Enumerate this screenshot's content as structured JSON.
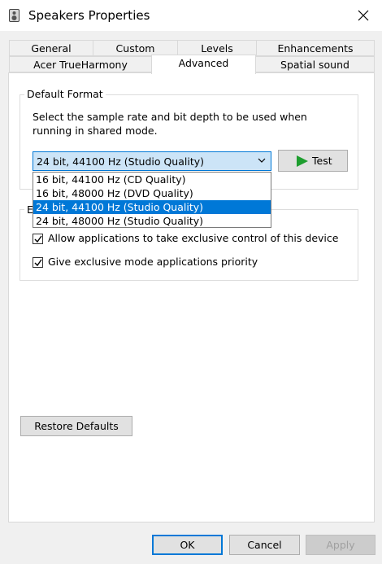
{
  "window": {
    "title": "Speakers Properties"
  },
  "tabs": {
    "row1": [
      "General",
      "Custom",
      "Levels",
      "Enhancements"
    ],
    "row2": [
      "Acer TrueHarmony",
      "Advanced",
      "Spatial sound"
    ],
    "active": "Advanced"
  },
  "default_format": {
    "legend": "Default Format",
    "description": "Select the sample rate and bit depth to be used when running in shared mode.",
    "selected": "24 bit, 44100 Hz (Studio Quality)",
    "options": [
      "16 bit, 44100 Hz (CD Quality)",
      "16 bit, 48000 Hz (DVD Quality)",
      "24 bit, 44100 Hz (Studio Quality)",
      "24 bit, 48000 Hz (Studio Quality)"
    ],
    "highlighted_index": 2,
    "test_label": "Test"
  },
  "exclusive_mode": {
    "legend_visible": "E",
    "allow_label": "Allow applications to take exclusive control of this device",
    "allow_checked": true,
    "priority_label": "Give exclusive mode applications priority",
    "priority_checked": true
  },
  "restore_defaults_label": "Restore Defaults",
  "footer": {
    "ok": "OK",
    "cancel": "Cancel",
    "apply": "Apply"
  },
  "colors": {
    "accent": "#0078d7",
    "selection_bg": "#cce4f7",
    "play_green": "#1e9e2f"
  }
}
